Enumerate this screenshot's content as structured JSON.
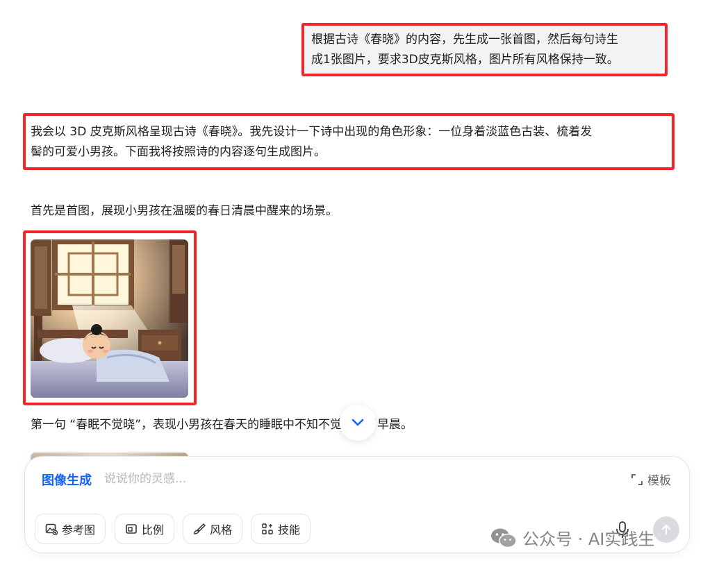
{
  "conversation": {
    "user_message": {
      "line1": "根据古诗《春晓》的内容，先生成一张首图，然后每句诗生",
      "line2": "成1张图片，要求3D皮克斯风格，图片所有风格保持一致。"
    },
    "ai_intro": {
      "line1": "我会以 3D 皮克斯风格呈现古诗《春晓》。我先设计一下诗中出现的角色形象：一位身着淡蓝色古装、梳着发",
      "line2": "髻的可爱小男孩。下面我将按照诗的内容逐句生成图片。"
    },
    "ai_first": "首先是首图，展现小男孩在温暖的春日清晨中醒来的场景。",
    "ai_second": "第一句 “春眠不觉晓”，表现小男孩在春天的睡眠中不知不觉就到了早晨。"
  },
  "composer": {
    "mode_label": "图像生成",
    "input_placeholder": "说说你的灵感...",
    "template_label": "模板",
    "chips": {
      "reference": "参考图",
      "ratio": "比例",
      "style": "风格",
      "skill": "技能"
    }
  },
  "watermark": "公众号 · AI实践生",
  "colors": {
    "accent": "#1664ff",
    "highlight_border": "#f0262a",
    "user_bubble_bg": "#f2f3f5"
  }
}
